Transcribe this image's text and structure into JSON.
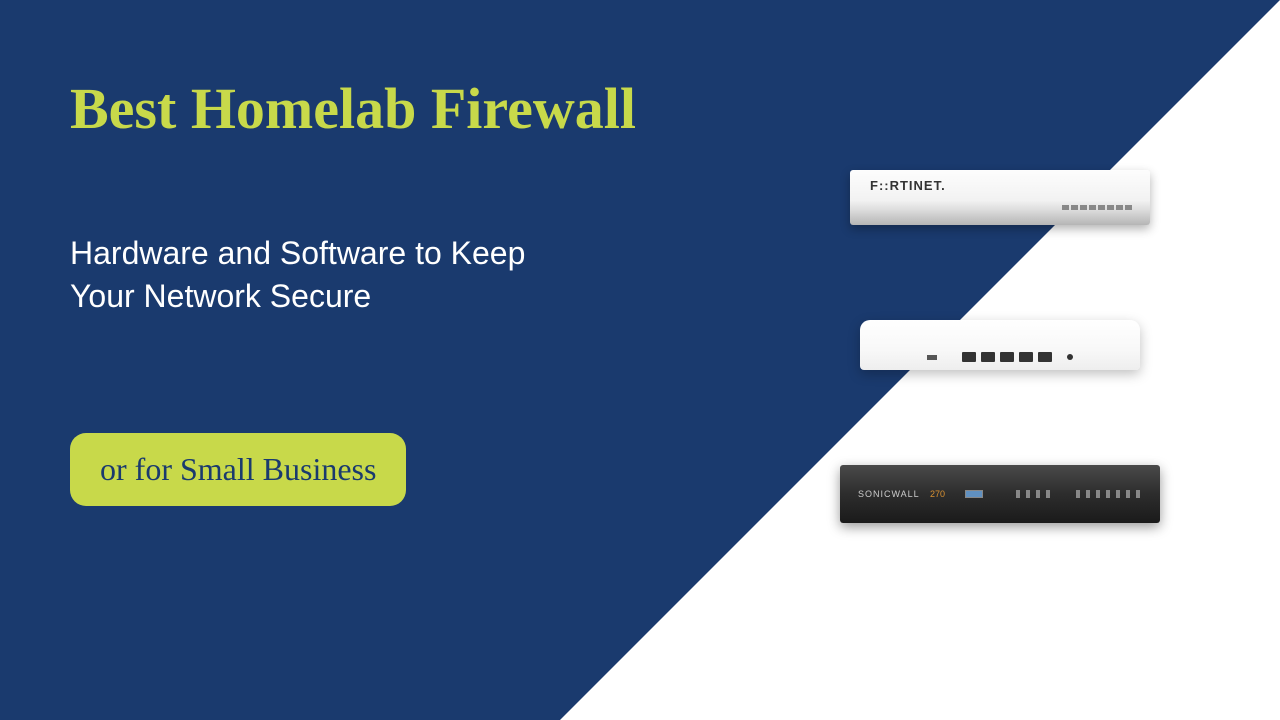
{
  "title": "Best Homelab Firewall",
  "subtitle": "Hardware and Software to Keep Your Network Secure",
  "badge": "or for Small Business",
  "devices": {
    "top_brand": "FORTINET",
    "bottom_brand": "SONICWALL",
    "bottom_model": "270"
  }
}
